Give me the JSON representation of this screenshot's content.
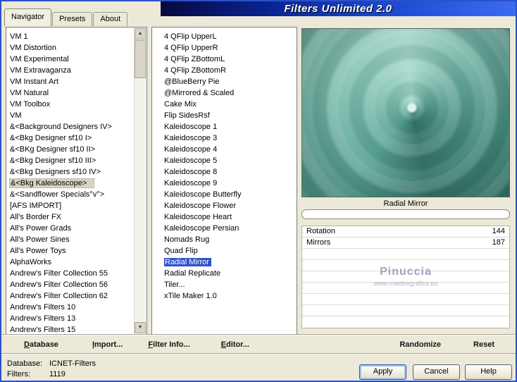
{
  "window": {
    "title": "Filters Unlimited 2.0"
  },
  "tabs": [
    {
      "label": "Navigator",
      "active": true
    },
    {
      "label": "Presets",
      "active": false
    },
    {
      "label": "About",
      "active": false
    }
  ],
  "left_list": {
    "selected_item": "&<Bkg Kaleidoscope>",
    "items": [
      "VM 1",
      "VM Distortion",
      "VM Experimental",
      "VM Extravaganza",
      "VM Instant Art",
      "VM Natural",
      "VM Toolbox",
      "VM",
      "&<Background Designers IV>",
      "&<Bkg Designer sf10 I>",
      "&<BKg Designer sf10 II>",
      "&<Bkg Designer sf10 III>",
      "&<Bkg Designers sf10 IV>",
      "&<Bkg Kaleidoscope>",
      "&<Sandflower Specials°v°>",
      "[AFS IMPORT]",
      "All's Border FX",
      "All's Power Grads",
      "All's Power Sines",
      "All's Power Toys",
      "AlphaWorks",
      "Andrew's Filter Collection 55",
      "Andrew's Filter Collection 56",
      "Andrew's Filter Collection 62",
      "Andrew's Filters 10",
      "Andrew's Filters 13",
      "Andrew's Filters 15"
    ]
  },
  "filter_list": {
    "selected_item": "Radial Mirror",
    "items": [
      "4 QFlip UpperL",
      "4 QFlip UpperR",
      "4 QFlip ZBottomL",
      "4 QFlip ZBottomR",
      "@BlueBerry Pie",
      "@Mirrored & Scaled",
      "Cake Mix",
      "Flip SidesRsf",
      "Kaleidoscope 1",
      "Kaleidoscope 3",
      "Kaleidoscope 4",
      "Kaleidoscope 5",
      "Kaleidoscope 8",
      "Kaleidoscope 9",
      "Kaleidoscope Butterfly",
      "Kaleidoscope Flower",
      "Kaleidoscope Heart",
      "Kaleidoscope Persian",
      "Nomads Rug",
      "Quad Flip",
      "Radial Mirror",
      "Radial Replicate",
      "Tiler...",
      "xTile Maker 1.0"
    ]
  },
  "preview": {
    "caption": "Radial Mirror"
  },
  "params": {
    "rows": [
      {
        "label": "Rotation",
        "value": "144"
      },
      {
        "label": "Mirrors",
        "value": "187"
      }
    ],
    "empty_row_count": 7,
    "watermark_line1": "Pinuccia",
    "watermark_line2": "www.maidiregrafica.eu"
  },
  "toolbar": {
    "database": "Database",
    "import": "Import...",
    "filter_info": "Filter Info...",
    "editor": "Editor...",
    "randomize": "Randomize",
    "reset": "Reset"
  },
  "status": {
    "database_label": "Database:",
    "database_value": "ICNET-Filters",
    "filters_label": "Filters:",
    "filters_value": "1119"
  },
  "buttons": {
    "apply": "Apply",
    "cancel": "Cancel",
    "help": "Help"
  },
  "icons": {
    "scroll_up": "▲",
    "scroll_down": "▼"
  },
  "colors": {
    "dialog_bg": "#ece9d8",
    "banner_blue": "#1d4ad0",
    "selection_blue": "#3152c8",
    "selection_inactive": "#d7d3c4",
    "watermark": "#a89fc2"
  }
}
